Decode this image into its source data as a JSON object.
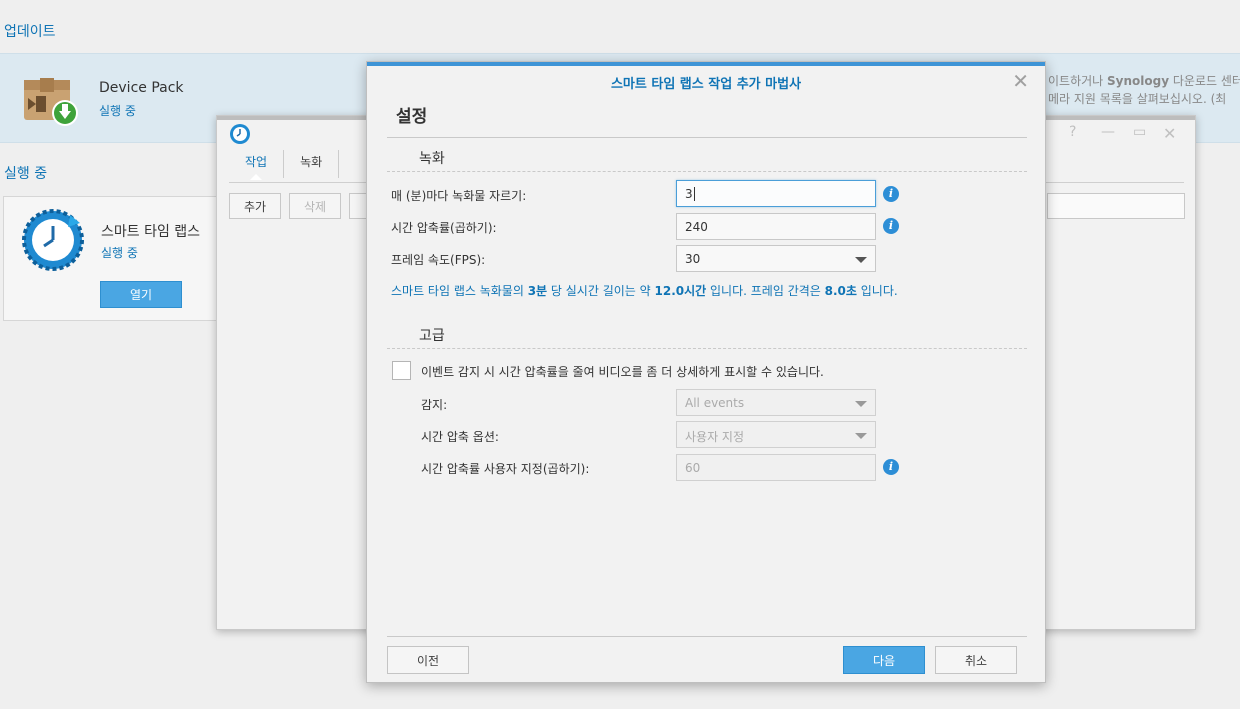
{
  "background": {
    "update_title": "업데이트",
    "running_title": "실행 중",
    "update_package": {
      "name": "Device Pack",
      "status": "실행 중",
      "desc_line1_prefix": "이트하거나 ",
      "desc_line1_bold": "Synology",
      "desc_line1_suffix": " 다운로드 센터",
      "desc_line2": "메라 지원 목록을 살펴보십시오. (최"
    },
    "running_package": {
      "name": "스마트 타임 랩스",
      "status": "실행 중",
      "open_button": "열기"
    }
  },
  "app_window": {
    "tabs": [
      {
        "label": "작업",
        "active": true
      },
      {
        "label": "녹화",
        "active": false
      }
    ],
    "buttons": {
      "add": "추가",
      "delete": "삭제"
    }
  },
  "dialog": {
    "title": "스마트 타임 랩스 작업 추가 마법사",
    "heading": "설정",
    "recording_group": "녹화",
    "advanced_group": "고급",
    "fields": {
      "cut_every_label": "매 (분)마다 녹화물 자르기:",
      "cut_every_value": "3",
      "compression_label": "시간 압축률(곱하기):",
      "compression_value": "240",
      "fps_label": "프레임 속도(FPS):",
      "fps_value": "30"
    },
    "summary": {
      "part1": "스마트 타임 랩스 녹화물의 ",
      "bold1": "3분",
      "part2": " 당 실시간 길이는 약 ",
      "bold2": "12.0시간",
      "part3": " 입니다. 프레임 간격은 ",
      "bold3": "8.0초",
      "part4": " 입니다."
    },
    "advanced": {
      "checkbox_label": "이벤트 감지 시 시간 압축률을 줄여 비디오를 좀 더 상세하게 표시할 수 있습니다.",
      "checkbox_checked": false,
      "detection_label": "감지:",
      "detection_value": "All events",
      "compression_option_label": "시간 압축 옵션:",
      "compression_option_value": "사용자 지정",
      "custom_compression_label": "시간 압축률 사용자 지정(곱하기):",
      "custom_compression_value": "60"
    },
    "footer": {
      "prev": "이전",
      "next": "다음",
      "cancel": "취소"
    }
  }
}
